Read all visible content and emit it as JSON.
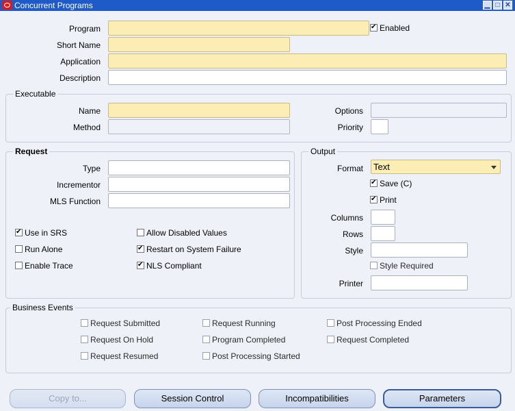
{
  "window": {
    "title": "Concurrent Programs"
  },
  "header": {
    "program_label": "Program",
    "enabled_label": "Enabled",
    "enabled_checked": true,
    "short_name_label": "Short Name",
    "application_label": "Application",
    "description_label": "Description"
  },
  "executable": {
    "title": "Executable",
    "name_label": "Name",
    "method_label": "Method",
    "options_label": "Options",
    "priority_label": "Priority"
  },
  "request": {
    "title": "Request",
    "type_label": "Type",
    "incrementor_label": "Incrementor",
    "mls_label": "MLS Function",
    "checks": {
      "use_in_srs": {
        "label": "Use in SRS",
        "checked": true
      },
      "run_alone": {
        "label": "Run Alone",
        "checked": false
      },
      "enable_trace": {
        "label": "Enable Trace",
        "checked": false
      },
      "allow_disabled": {
        "label": "Allow Disabled Values",
        "checked": false
      },
      "restart": {
        "label": "Restart on System Failure",
        "checked": true
      },
      "nls": {
        "label": "NLS Compliant",
        "checked": true
      }
    }
  },
  "output": {
    "title": "Output",
    "format_label": "Format",
    "format_value": "Text",
    "save_label": "Save (C)",
    "save_checked": true,
    "print_label": "Print",
    "print_checked": true,
    "columns_label": "Columns",
    "rows_label": "Rows",
    "style_label": "Style",
    "style_required_label": "Style Required",
    "style_required_checked": false,
    "printer_label": "Printer"
  },
  "business_events": {
    "title": "Business Events",
    "items": [
      "Request Submitted",
      "Request On Hold",
      "Request Resumed",
      "Request Running",
      "Program Completed",
      "Post Processing Started",
      "Post Processing Ended",
      "Request Completed"
    ]
  },
  "buttons": {
    "copy": "Copy to...",
    "session": "Session Control",
    "incompat": "Incompatibilities",
    "params": "Parameters"
  }
}
